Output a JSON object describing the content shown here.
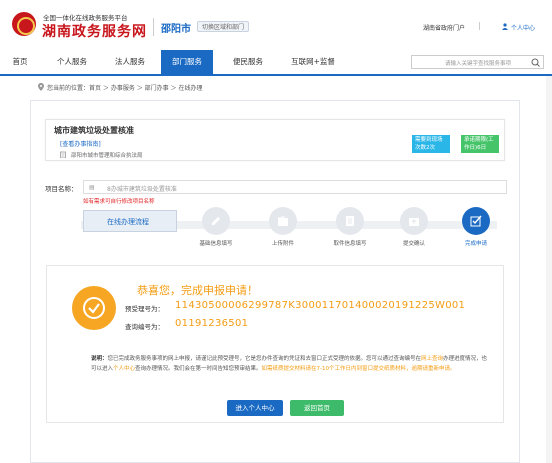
{
  "header": {
    "logo_small": "全国一体化在线政务服务平台",
    "logo_big": "湖南政务服务网",
    "city": "邵阳市",
    "city_switch": "切换区域和部门",
    "portal_link": "湖南省政府门户",
    "user_link": "个人中心"
  },
  "nav": {
    "items": [
      {
        "label": "首页"
      },
      {
        "label": "个人服务"
      },
      {
        "label": "法人服务"
      },
      {
        "label": "部门服务"
      },
      {
        "label": "便民服务"
      },
      {
        "label": "互联网+监督"
      }
    ],
    "active_index": 3,
    "search_placeholder": "请输入关键字查找服务事项"
  },
  "breadcrumb": {
    "prefix": "您当前的位置：",
    "path": "首页 ＞ 办事服务 ＞ 部门办事 ＞ 在线办理"
  },
  "item": {
    "title": "城市建筑垃圾处置核准",
    "guide_link": "[查看办事指南]",
    "department": "邵阳市城市管理和综合执法局",
    "visits_badge_line1": "需要到现场",
    "visits_badge_line2": "次数2次",
    "days_badge_line1": "承诺期限(工",
    "days_badge_line2": "作日)6日"
  },
  "form": {
    "project_label": "项目名称：",
    "project_icon": "▤",
    "project_placeholder": "8办城市建筑垃圾处置核准",
    "project_hint": "如有需求可自行修改项目名称"
  },
  "steps": {
    "start_label": "在线办理流程",
    "items": [
      {
        "label": "基础信息填写",
        "icon": "pencil-icon",
        "done": false
      },
      {
        "label": "上传附件",
        "icon": "upload-folder-icon",
        "done": false
      },
      {
        "label": "取件信息填写",
        "icon": "document-icon",
        "done": false
      },
      {
        "label": "提交确认",
        "icon": "submit-folder-icon",
        "done": false
      },
      {
        "label": "完成申请",
        "icon": "check-edit-icon",
        "done": true
      }
    ]
  },
  "result": {
    "title": "恭喜您，完成申报申请！",
    "pre_number_label": "预受理号为：",
    "pre_number": "11430500006299787K300011701400020191225W001",
    "query_label": "查询编号为：",
    "query_number": "01191236501",
    "desc_label": "说明：",
    "desc_part1": "您已完成政务服务事项的网上申报，请谨记此预受理号，它是您办件查询的凭证和去窗口正式受理的依据。您可以通过查询编号在",
    "desc_link1": "网上查询",
    "desc_part2": "办理进度情况，也可以进入",
    "desc_link2": "个人中心",
    "desc_part3": "查询办理情况。我们会在第一时间告知您预审结果。",
    "desc_orange": "如需纸质提交材料请在7-10个工作日内到窗口提交纸质材料，逾期请重新申请。",
    "btn_personal": "进入个人中心",
    "btn_home": "返回首页"
  },
  "colors": {
    "brand_red": "#c8161d",
    "primary_blue": "#1a6ac4",
    "accent_orange": "#f39c12",
    "success_green": "#3dbb6a",
    "badge_cyan": "#2bb6e8"
  }
}
